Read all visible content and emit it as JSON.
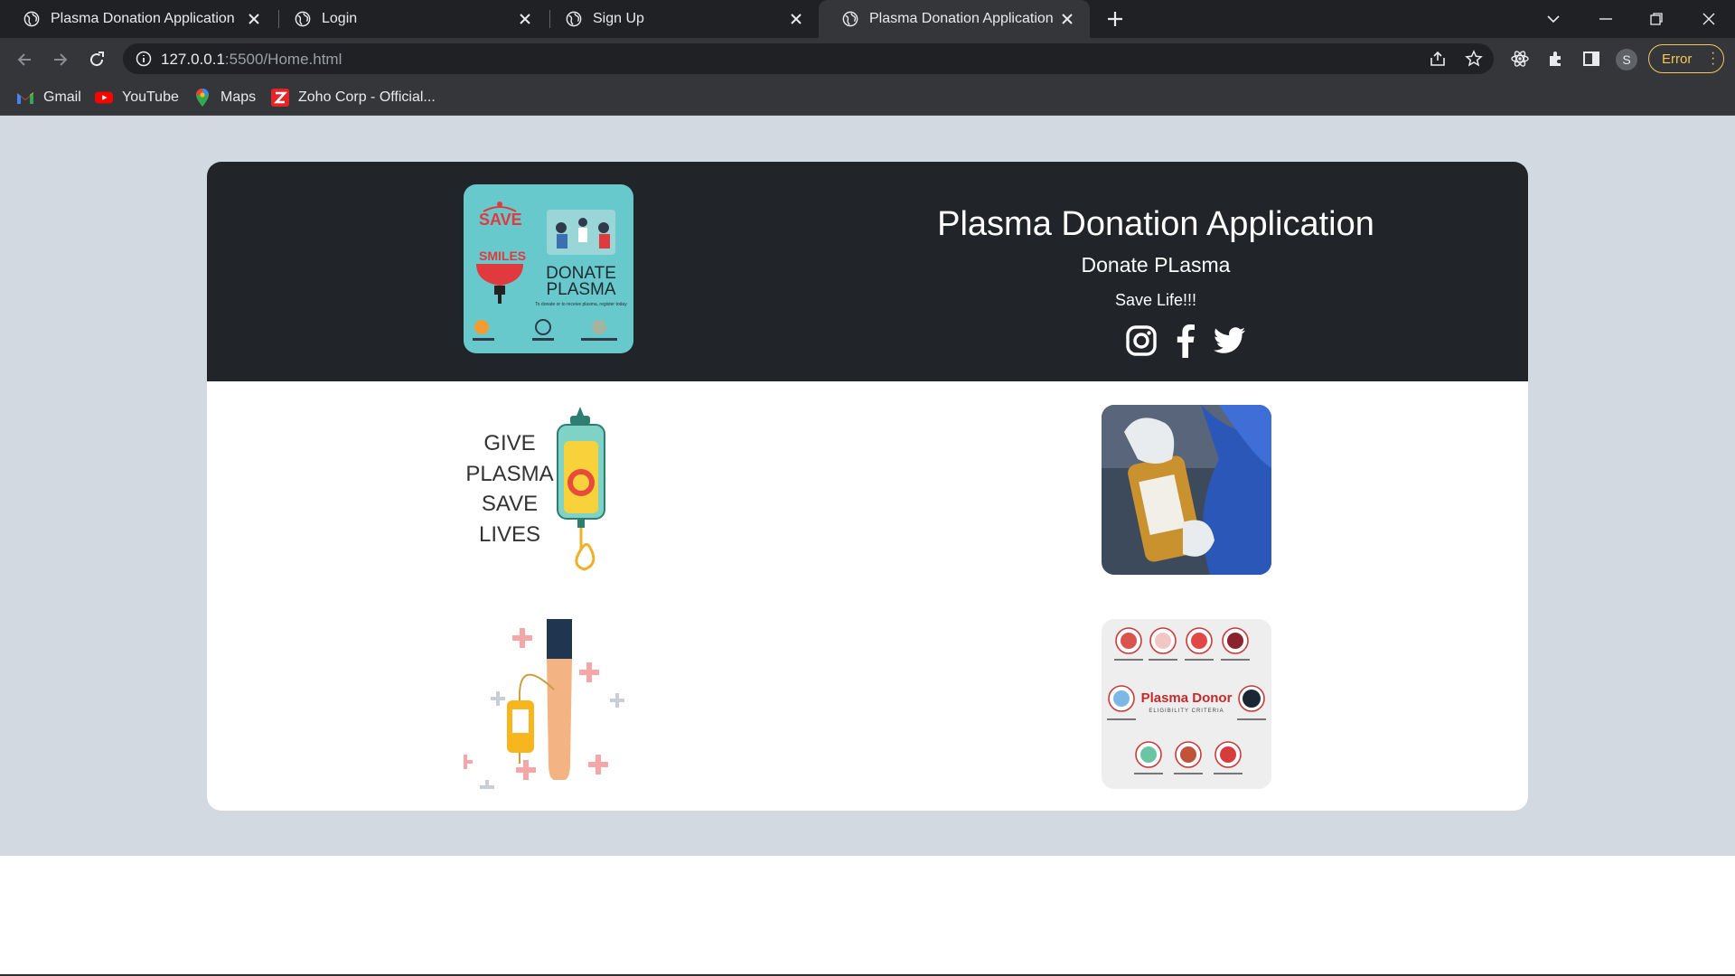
{
  "browser": {
    "tabs": [
      {
        "title": "Plasma Donation Application",
        "active": false
      },
      {
        "title": "Login",
        "active": false
      },
      {
        "title": "Sign Up",
        "active": false
      },
      {
        "title": "Plasma Donation Application",
        "active": true
      }
    ],
    "address": {
      "host": "127.0.0.1",
      "path": ":5500/Home.html"
    },
    "profile_initial": "S",
    "error_label": "Error",
    "bookmarks": [
      {
        "label": "Gmail",
        "icon": "gmail-icon"
      },
      {
        "label": "YouTube",
        "icon": "youtube-icon"
      },
      {
        "label": "Maps",
        "icon": "maps-icon"
      },
      {
        "label": "Zoho Corp - Official...",
        "icon": "zoho-icon"
      }
    ]
  },
  "page": {
    "hero": {
      "title": "Plasma Donation Application",
      "subtitle": "Donate PLasma",
      "tagline": "Save Life!!!",
      "social": [
        "instagram-icon",
        "facebook-icon",
        "twitter-icon"
      ]
    },
    "logo_text": {
      "save": "SAVE",
      "smiles": "SMILES",
      "donate": "DONATE",
      "plasma": "PLASMA",
      "small": "To donate or to receive plasma, register today"
    },
    "tiles": {
      "give_plasma": [
        "GIVE",
        "PLASMA",
        "SAVE",
        "LIVES"
      ],
      "donor_title": "Plasma Donor",
      "donor_sub": "ELIGIBILITY CRITERIA"
    }
  },
  "colors": {
    "chrome_dark": "#202124",
    "chrome_mid": "#35363a",
    "page_bg": "#d3d9e0",
    "hero_bg": "#212529",
    "accent_error": "#f6c659",
    "logo_teal": "#68c9cc",
    "blood_red": "#e03a3e"
  }
}
